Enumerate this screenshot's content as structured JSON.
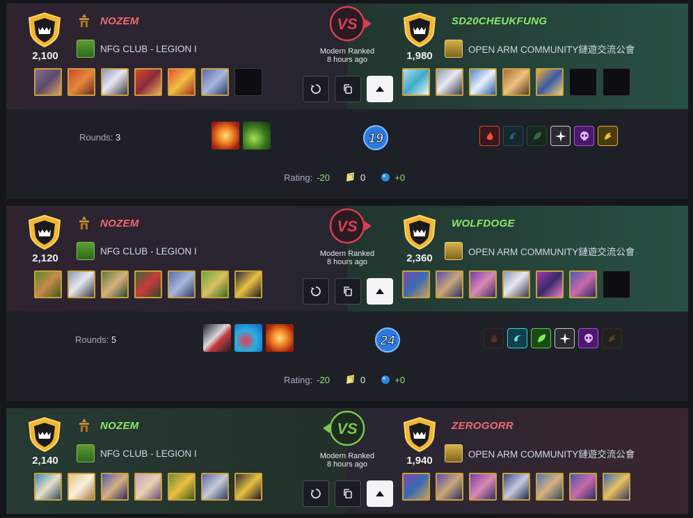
{
  "battles": [
    {
      "left": {
        "rating": "2,100",
        "name": "NOZEM",
        "guild": "NFG CLUB - LEGION I",
        "outcome": "lose"
      },
      "right": {
        "rating": "1,980",
        "name": "SD20CHEUKFUNG",
        "guild": "OPEN ARM COMMUNITY鏈遊交流公會",
        "outcome": "win"
      },
      "format": "Modern Ranked",
      "time": "8 hours ago",
      "rounds_label": "Rounds:",
      "rounds": "3",
      "mana": "19",
      "rating_label": "Rating:",
      "rating_change": "-20",
      "dec": "0",
      "sps": "+0"
    },
    {
      "left": {
        "rating": "2,120",
        "name": "NOZEM",
        "guild": "NFG CLUB - LEGION I",
        "outcome": "lose"
      },
      "right": {
        "rating": "2,360",
        "name": "WOLFDOGE",
        "guild": "OPEN ARM COMMUNITY鏈遊交流公會",
        "outcome": "win"
      },
      "format": "Modern Ranked",
      "time": "8 hours ago",
      "rounds_label": "Rounds:",
      "rounds": "5",
      "mana": "24",
      "rating_label": "Rating:",
      "rating_change": "-20",
      "dec": "0",
      "sps": "+0"
    },
    {
      "left": {
        "rating": "2,140",
        "name": "NOZEM",
        "guild": "NFG CLUB - LEGION I",
        "outcome": "win"
      },
      "right": {
        "rating": "1,940",
        "name": "ZEROGORR",
        "guild": "OPEN ARM COMMUNITY鏈遊交流公會",
        "outcome": "lose"
      },
      "format": "Modern Ranked",
      "time": "8 hours ago"
    }
  ],
  "vs_label": "VS",
  "colors": {
    "win": "#8ce86a",
    "lose": "#f06a74",
    "card_border": "#c9a23a"
  },
  "icons": [
    "league-shield-icon",
    "rank-badge-icon",
    "replay-icon",
    "copy-icon",
    "collapse-icon",
    "fire-splinter-icon",
    "water-splinter-icon",
    "earth-splinter-icon",
    "life-splinter-icon",
    "death-splinter-icon",
    "dragon-splinter-icon",
    "dec-token-icon",
    "sps-token-icon"
  ]
}
